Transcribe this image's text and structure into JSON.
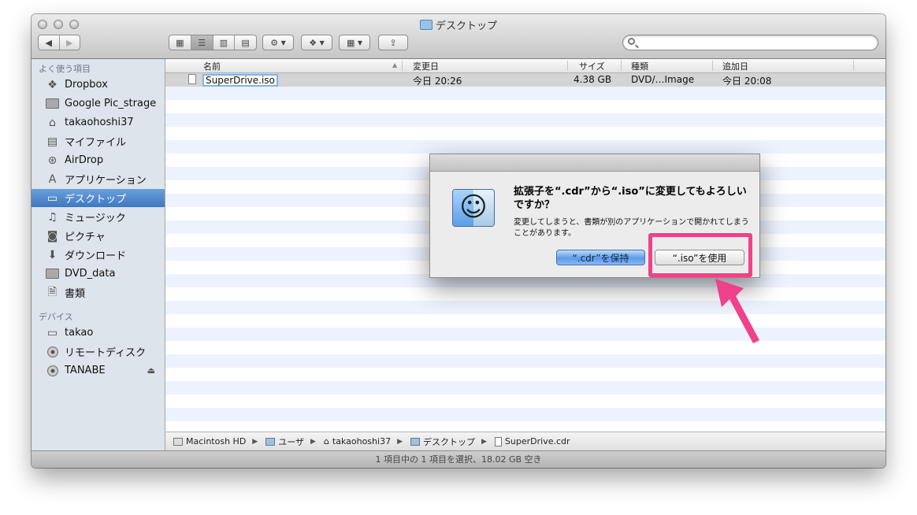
{
  "window": {
    "title": "デスクトップ"
  },
  "search": {
    "placeholder": ""
  },
  "sidebar": {
    "favorites_header": "よく使う項目",
    "favorites": [
      {
        "label": "Dropbox",
        "icon": "dropbox-icon"
      },
      {
        "label": "Google Pic_strage",
        "icon": "folder-icon"
      },
      {
        "label": "takaohoshi37",
        "icon": "home-icon"
      },
      {
        "label": "マイファイル",
        "icon": "all-files-icon"
      },
      {
        "label": "AirDrop",
        "icon": "airdrop-icon"
      },
      {
        "label": "アプリケーション",
        "icon": "applications-icon"
      },
      {
        "label": "デスクトップ",
        "icon": "desktop-icon",
        "selected": true
      },
      {
        "label": "ミュージック",
        "icon": "music-icon"
      },
      {
        "label": "ピクチャ",
        "icon": "camera-icon"
      },
      {
        "label": "ダウンロード",
        "icon": "download-icon"
      },
      {
        "label": "DVD_data",
        "icon": "folder-icon"
      },
      {
        "label": "書類",
        "icon": "documents-icon"
      }
    ],
    "devices_header": "デバイス",
    "devices": [
      {
        "label": "takao",
        "icon": "laptop-icon"
      },
      {
        "label": "リモートディスク",
        "icon": "disc-icon"
      },
      {
        "label": "TANABE",
        "icon": "disc-icon",
        "eject": true
      }
    ]
  },
  "list": {
    "columns": [
      "名前",
      "変更日",
      "サイズ",
      "種類",
      "追加日"
    ],
    "rows": [
      {
        "name": "SuperDrive.iso",
        "modified": "今日 20:26",
        "size": "4.38 GB",
        "kind": "DVD/…Image",
        "added": "今日 20:08"
      }
    ]
  },
  "pathbar": [
    "Macintosh HD",
    "ユーザ",
    "takaohoshi37",
    "デスクトップ",
    "SuperDrive.cdr"
  ],
  "status": "1 項目中の 1 項目を選択、18.02 GB 空き",
  "dialog": {
    "message": "拡張子を“.cdr”から“.iso”に変更してもよろしいですか？",
    "info": "変更してしまうと、書類が別のアプリケーションで開かれてしまうことがあります。",
    "keep_button": "“.cdr”を保持",
    "use_button": "“.iso”を使用"
  },
  "colors": {
    "highlight": "#f0418a",
    "sidebar_selection": "#3f78c2",
    "row_stripe": "#edf3fe"
  }
}
